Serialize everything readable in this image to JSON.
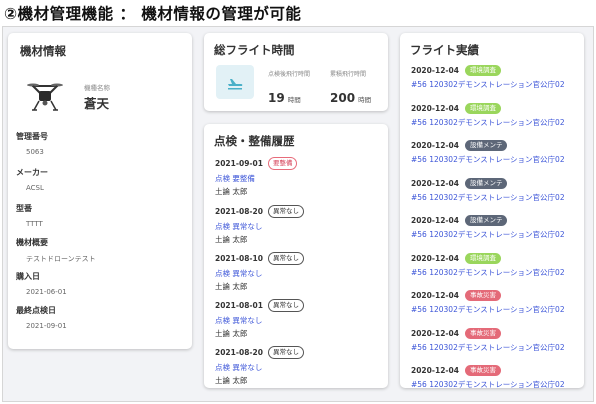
{
  "heading": "②機材管理機能 ： 機材情報の管理が可能",
  "equipment": {
    "title": "機材情報",
    "model_label": "機種名称",
    "model_name": "蒼天",
    "fields": [
      {
        "label": "管理番号",
        "value": "5063"
      },
      {
        "label": "メーカー",
        "value": "ACSL"
      },
      {
        "label": "型番",
        "value": "TTTT"
      },
      {
        "label": "機材概要",
        "value": "テストドローンテスト"
      },
      {
        "label": "購入日",
        "value": "2021-06-01"
      },
      {
        "label": "最終点検日",
        "value": "2021-09-01"
      }
    ]
  },
  "flight_time": {
    "title": "総フライト時間",
    "icon": "airplane-takeoff-icon",
    "stats": [
      {
        "label": "点検後飛行時間",
        "value": "19",
        "unit": "時間"
      },
      {
        "label": "累積飛行時間",
        "value": "200",
        "unit": "時間"
      }
    ]
  },
  "maintenance": {
    "title": "点検・整備履歴",
    "entries": [
      {
        "date": "2021-09-01",
        "badge": "要整備",
        "badge_style": "outline-red",
        "link": "点検 要整備",
        "person": "土論 太郎"
      },
      {
        "date": "2021-08-20",
        "badge": "異常なし",
        "badge_style": "outline-dark",
        "link": "点検 異常なし",
        "person": "土論 太郎"
      },
      {
        "date": "2021-08-10",
        "badge": "異常なし",
        "badge_style": "outline-dark",
        "link": "点検 異常なし",
        "person": "土論 太郎"
      },
      {
        "date": "2021-08-01",
        "badge": "異常なし",
        "badge_style": "outline-dark",
        "link": "点検 異常なし",
        "person": "土論 太郎"
      },
      {
        "date": "2021-08-20",
        "badge": "異常なし",
        "badge_style": "outline-dark",
        "link": "点検 異常なし",
        "person": "土論 太郎"
      }
    ]
  },
  "records": {
    "title": "フライト実績",
    "tag_colors": {
      "環境調査": {
        "bg": "#9ad65c",
        "fg": "#ffffff"
      },
      "設備メンテ": {
        "bg": "#5d6778",
        "fg": "#ffffff"
      },
      "事故災害": {
        "bg": "#e46a78",
        "fg": "#ffffff"
      }
    },
    "entries": [
      {
        "date": "2020-12-04",
        "tag": "環境調査",
        "link": "#56 120302デモンストレーション官公庁02"
      },
      {
        "date": "2020-12-04",
        "tag": "環境調査",
        "link": "#56 120302デモンストレーション官公庁02"
      },
      {
        "date": "2020-12-04",
        "tag": "設備メンテ",
        "link": "#56 120302デモンストレーション官公庁02"
      },
      {
        "date": "2020-12-04",
        "tag": "設備メンテ",
        "link": "#56 120302デモンストレーション官公庁02"
      },
      {
        "date": "2020-12-04",
        "tag": "設備メンテ",
        "link": "#56 120302デモンストレーション官公庁02"
      },
      {
        "date": "2020-12-04",
        "tag": "環境調査",
        "link": "#56 120302デモンストレーション官公庁02"
      },
      {
        "date": "2020-12-04",
        "tag": "事故災害",
        "link": "#56 120302デモンストレーション官公庁02"
      },
      {
        "date": "2020-12-04",
        "tag": "事故災害",
        "link": "#56 120302デモンストレーション官公庁02"
      },
      {
        "date": "2020-12-04",
        "tag": "事故災害",
        "link": "#56 120302デモンストレーション官公庁02"
      }
    ]
  }
}
